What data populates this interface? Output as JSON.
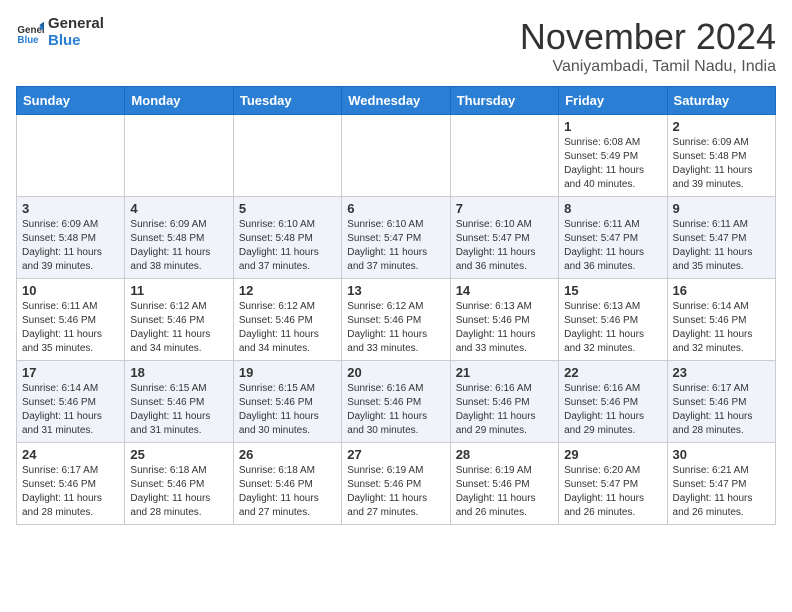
{
  "logo": {
    "text1": "General",
    "text2": "Blue"
  },
  "title": "November 2024",
  "location": "Vaniyambadi, Tamil Nadu, India",
  "weekdays": [
    "Sunday",
    "Monday",
    "Tuesday",
    "Wednesday",
    "Thursday",
    "Friday",
    "Saturday"
  ],
  "weeks": [
    [
      {
        "day": "",
        "info": ""
      },
      {
        "day": "",
        "info": ""
      },
      {
        "day": "",
        "info": ""
      },
      {
        "day": "",
        "info": ""
      },
      {
        "day": "",
        "info": ""
      },
      {
        "day": "1",
        "info": "Sunrise: 6:08 AM\nSunset: 5:49 PM\nDaylight: 11 hours\nand 40 minutes."
      },
      {
        "day": "2",
        "info": "Sunrise: 6:09 AM\nSunset: 5:48 PM\nDaylight: 11 hours\nand 39 minutes."
      }
    ],
    [
      {
        "day": "3",
        "info": "Sunrise: 6:09 AM\nSunset: 5:48 PM\nDaylight: 11 hours\nand 39 minutes."
      },
      {
        "day": "4",
        "info": "Sunrise: 6:09 AM\nSunset: 5:48 PM\nDaylight: 11 hours\nand 38 minutes."
      },
      {
        "day": "5",
        "info": "Sunrise: 6:10 AM\nSunset: 5:48 PM\nDaylight: 11 hours\nand 37 minutes."
      },
      {
        "day": "6",
        "info": "Sunrise: 6:10 AM\nSunset: 5:47 PM\nDaylight: 11 hours\nand 37 minutes."
      },
      {
        "day": "7",
        "info": "Sunrise: 6:10 AM\nSunset: 5:47 PM\nDaylight: 11 hours\nand 36 minutes."
      },
      {
        "day": "8",
        "info": "Sunrise: 6:11 AM\nSunset: 5:47 PM\nDaylight: 11 hours\nand 36 minutes."
      },
      {
        "day": "9",
        "info": "Sunrise: 6:11 AM\nSunset: 5:47 PM\nDaylight: 11 hours\nand 35 minutes."
      }
    ],
    [
      {
        "day": "10",
        "info": "Sunrise: 6:11 AM\nSunset: 5:46 PM\nDaylight: 11 hours\nand 35 minutes."
      },
      {
        "day": "11",
        "info": "Sunrise: 6:12 AM\nSunset: 5:46 PM\nDaylight: 11 hours\nand 34 minutes."
      },
      {
        "day": "12",
        "info": "Sunrise: 6:12 AM\nSunset: 5:46 PM\nDaylight: 11 hours\nand 34 minutes."
      },
      {
        "day": "13",
        "info": "Sunrise: 6:12 AM\nSunset: 5:46 PM\nDaylight: 11 hours\nand 33 minutes."
      },
      {
        "day": "14",
        "info": "Sunrise: 6:13 AM\nSunset: 5:46 PM\nDaylight: 11 hours\nand 33 minutes."
      },
      {
        "day": "15",
        "info": "Sunrise: 6:13 AM\nSunset: 5:46 PM\nDaylight: 11 hours\nand 32 minutes."
      },
      {
        "day": "16",
        "info": "Sunrise: 6:14 AM\nSunset: 5:46 PM\nDaylight: 11 hours\nand 32 minutes."
      }
    ],
    [
      {
        "day": "17",
        "info": "Sunrise: 6:14 AM\nSunset: 5:46 PM\nDaylight: 11 hours\nand 31 minutes."
      },
      {
        "day": "18",
        "info": "Sunrise: 6:15 AM\nSunset: 5:46 PM\nDaylight: 11 hours\nand 31 minutes."
      },
      {
        "day": "19",
        "info": "Sunrise: 6:15 AM\nSunset: 5:46 PM\nDaylight: 11 hours\nand 30 minutes."
      },
      {
        "day": "20",
        "info": "Sunrise: 6:16 AM\nSunset: 5:46 PM\nDaylight: 11 hours\nand 30 minutes."
      },
      {
        "day": "21",
        "info": "Sunrise: 6:16 AM\nSunset: 5:46 PM\nDaylight: 11 hours\nand 29 minutes."
      },
      {
        "day": "22",
        "info": "Sunrise: 6:16 AM\nSunset: 5:46 PM\nDaylight: 11 hours\nand 29 minutes."
      },
      {
        "day": "23",
        "info": "Sunrise: 6:17 AM\nSunset: 5:46 PM\nDaylight: 11 hours\nand 28 minutes."
      }
    ],
    [
      {
        "day": "24",
        "info": "Sunrise: 6:17 AM\nSunset: 5:46 PM\nDaylight: 11 hours\nand 28 minutes."
      },
      {
        "day": "25",
        "info": "Sunrise: 6:18 AM\nSunset: 5:46 PM\nDaylight: 11 hours\nand 28 minutes."
      },
      {
        "day": "26",
        "info": "Sunrise: 6:18 AM\nSunset: 5:46 PM\nDaylight: 11 hours\nand 27 minutes."
      },
      {
        "day": "27",
        "info": "Sunrise: 6:19 AM\nSunset: 5:46 PM\nDaylight: 11 hours\nand 27 minutes."
      },
      {
        "day": "28",
        "info": "Sunrise: 6:19 AM\nSunset: 5:46 PM\nDaylight: 11 hours\nand 26 minutes."
      },
      {
        "day": "29",
        "info": "Sunrise: 6:20 AM\nSunset: 5:47 PM\nDaylight: 11 hours\nand 26 minutes."
      },
      {
        "day": "30",
        "info": "Sunrise: 6:21 AM\nSunset: 5:47 PM\nDaylight: 11 hours\nand 26 minutes."
      }
    ]
  ]
}
